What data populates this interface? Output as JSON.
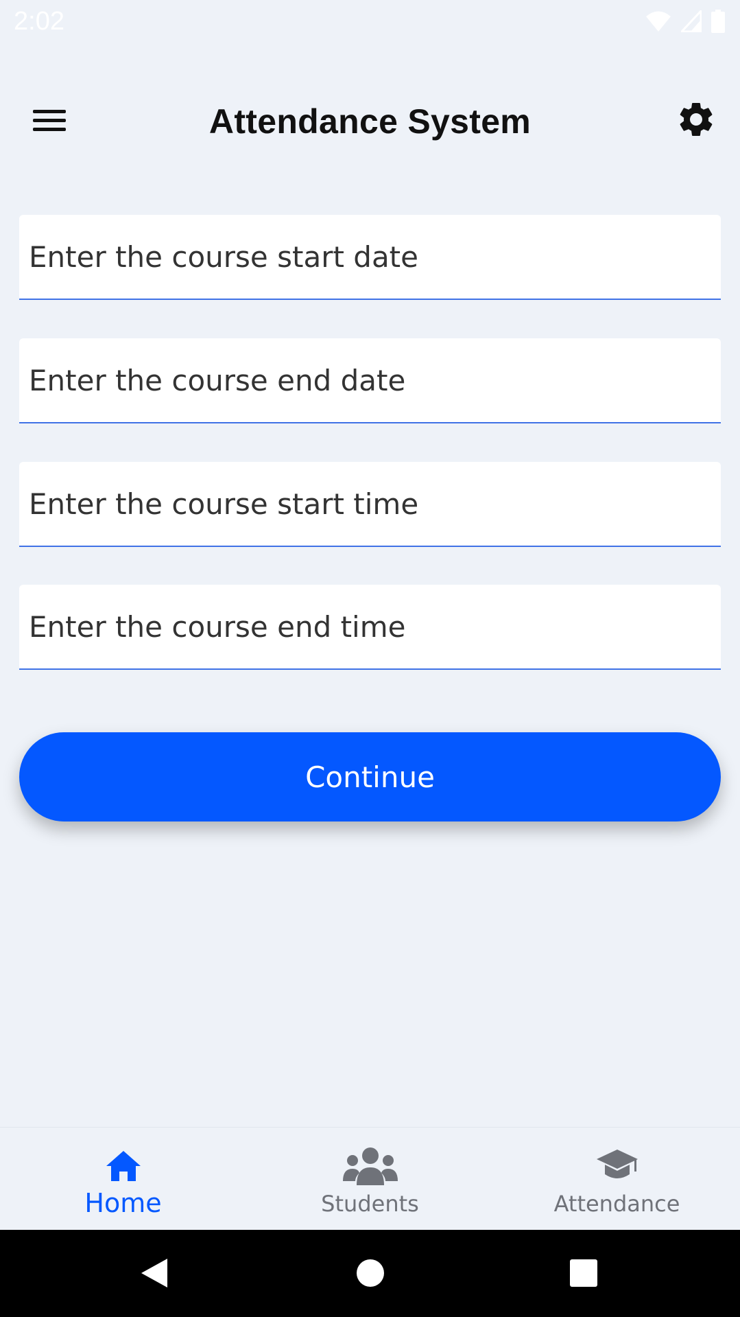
{
  "status_bar": {
    "time": "2:02"
  },
  "app_bar": {
    "title": "Attendance System"
  },
  "form": {
    "fields": [
      {
        "placeholder": "Enter the course start date",
        "value": ""
      },
      {
        "placeholder": "Enter the course end date",
        "value": ""
      },
      {
        "placeholder": "Enter the course start time",
        "value": ""
      },
      {
        "placeholder": "Enter the course end time",
        "value": ""
      }
    ],
    "continue_label": "Continue"
  },
  "bottom_nav": {
    "items": [
      {
        "label": "Home",
        "icon": "home-icon",
        "active": true
      },
      {
        "label": "Students",
        "icon": "people-group-icon",
        "active": false
      },
      {
        "label": "Attendance",
        "icon": "graduation-cap-icon",
        "active": false
      }
    ]
  },
  "colors": {
    "background": "#eef2f8",
    "accent": "#0458ff",
    "input_underline": "#3f72e6",
    "inactive_nav": "#6f7279"
  }
}
